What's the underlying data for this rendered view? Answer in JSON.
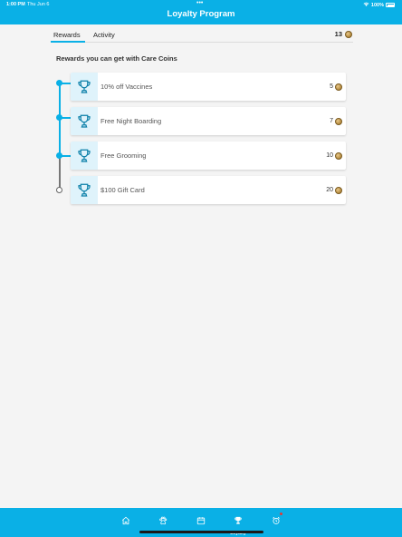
{
  "status_bar": {
    "time": "1:00 PM",
    "date": "Thu Jun 6",
    "dots": "•••",
    "battery_percent": "100%"
  },
  "header": {
    "title": "Loyalty Program"
  },
  "tabs": {
    "rewards_label": "Rewards",
    "activity_label": "Activity",
    "active": "rewards",
    "coin_balance": "13"
  },
  "section_title": "Rewards you can get with Care Coins",
  "rewards": [
    {
      "label": "10% off Vaccines",
      "cost": "5"
    },
    {
      "label": "Free Night Boarding",
      "cost": "7"
    },
    {
      "label": "Free Grooming",
      "cost": "10"
    },
    {
      "label": "$100 Gift Card",
      "cost": "20"
    }
  ],
  "bottom_nav": {
    "items": [
      {
        "icon": "home-icon"
      },
      {
        "icon": "paw-icon"
      },
      {
        "icon": "calendar-icon"
      },
      {
        "icon": "trophy-icon",
        "label": "Loyalty",
        "active": true
      },
      {
        "icon": "alarm-clock-icon",
        "badge": true
      }
    ]
  },
  "colors": {
    "primary": "#0ab0e6",
    "card_icon_bg": "#dff3fb",
    "badge": "#e53935"
  }
}
